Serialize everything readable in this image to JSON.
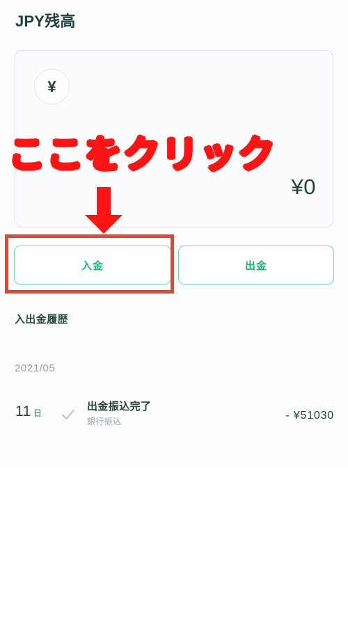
{
  "page": {
    "title": "JPY残高"
  },
  "balance_card": {
    "currency_icon": "yen-symbol-icon",
    "currency_glyph": "¥",
    "amount": "¥0"
  },
  "actions": {
    "deposit_label": "入金",
    "withdraw_label": "出金"
  },
  "history": {
    "heading": "入出金履歴",
    "month_group": "2021/05",
    "transactions": [
      {
        "day": "11",
        "day_unit": "日",
        "status_icon": "check-icon",
        "title": "出金振込完了",
        "subtitle": "銀行振込",
        "amount": "- ¥51030"
      }
    ]
  },
  "annotation": {
    "text": "ここをクリック",
    "arrow_icon": "down-arrow-icon",
    "highlight_target": "deposit-button",
    "text_color": "#FF1313",
    "arrow_color": "#FF1313",
    "box_color": "#E8452C"
  },
  "theme": {
    "title_color": "#22403A",
    "button_border": "#73D7BD",
    "button_text": "#17B877",
    "card_border": "#DDE2E4",
    "muted_text": "#96A3A2",
    "background": "#FFFFFF"
  }
}
